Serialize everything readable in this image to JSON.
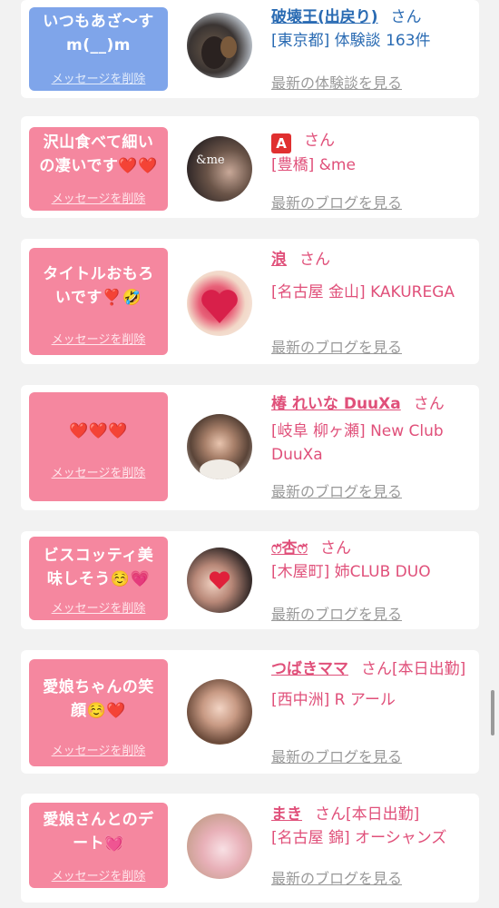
{
  "entries": [
    {
      "theme": "blue",
      "message": "いつもあざ〜すm(__)m",
      "delete_label": "メッセージを削除",
      "name": "破壊王(出戻り)",
      "suffix": "さん",
      "details": "[東京都] 体験談 163件",
      "more_label": "最新の体験談を見る",
      "avatar_icon": "horse-photo"
    },
    {
      "theme": "pink",
      "message": "沢山食べて細いの凄いです❤️❤️",
      "delete_label": "メッセージを削除",
      "name": "🅰",
      "suffix": "さん",
      "details": "[豊橋] &me",
      "more_label": "最新のブログを見る",
      "avatar_icon": "woman-photo"
    },
    {
      "theme": "pink",
      "message": "タイトルおもろいです❣️🤣",
      "delete_label": "メッセージを削除",
      "name": "浪",
      "suffix": "さん",
      "details": "[名古屋 金山] KAKUREGA",
      "more_label": "最新のブログを見る",
      "avatar_icon": "woman-photo"
    },
    {
      "theme": "pink",
      "message": "❤️❤️❤️",
      "delete_label": "メッセージを削除",
      "name": "椿 れいな DuuXa",
      "suffix": "さん",
      "details": "[岐阜 柳ヶ瀬] New Club DuuXa",
      "more_label": "最新のブログを見る",
      "avatar_icon": "woman-photo"
    },
    {
      "theme": "pink",
      "message": "ビスコッティ美味しそう☺️💗",
      "delete_label": "メッセージを削除",
      "name": "ෆ̈杏ෆ̈",
      "suffix": "さん",
      "details": "[木屋町] 姉CLUB DUO",
      "more_label": "最新のブログを見る",
      "avatar_icon": "woman-photo"
    },
    {
      "theme": "pink",
      "message": "愛娘ちゃんの笑顔☺️❤️",
      "delete_label": "メッセージを削除",
      "name": "つばきママ",
      "suffix": "さん[本日出勤]",
      "details": "[西中洲] R アール",
      "more_label": "最新のブログを見る",
      "avatar_icon": "woman-photo"
    },
    {
      "theme": "pink",
      "message": "愛娘さんとのデート💓",
      "delete_label": "メッセージを削除",
      "name": "まき",
      "suffix": "さん[本日出勤]",
      "details": "[名古屋 錦] オーシャンズ",
      "more_label": "最新のブログを見る",
      "avatar_icon": "woman-photo"
    }
  ]
}
